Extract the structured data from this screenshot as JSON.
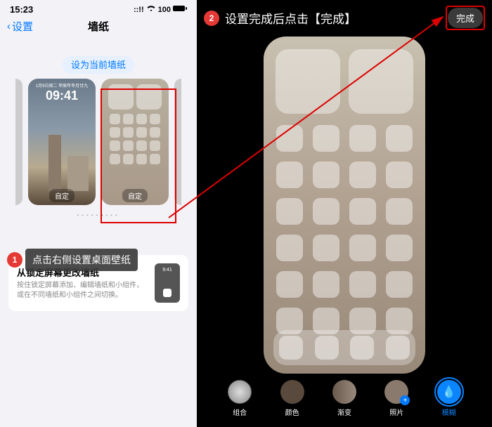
{
  "status": {
    "time": "15:23",
    "signal": "::!!",
    "wifi": "⧉",
    "battery": "100"
  },
  "nav": {
    "back": "设置",
    "title": "墙纸"
  },
  "set_current": "设为当前墙纸",
  "lock": {
    "date": "1月9日周二 甲辰年冬月廿九",
    "time": "09:41",
    "custom": "自定"
  },
  "home": {
    "custom": "自定"
  },
  "annotation1": {
    "num": "1",
    "text": "点击右侧设置桌面壁纸"
  },
  "info": {
    "title": "从锁定屏幕更改墙纸",
    "desc": "按住锁定屏幕添加、编辑墙纸和小组件，或在不同墙纸和小组件之间切换。"
  },
  "annotation2": {
    "num": "2",
    "text": "设置完成后点击【完成】"
  },
  "done": "完成",
  "options": {
    "combo": "组合",
    "color": "颜色",
    "gradient": "渐变",
    "photo": "照片",
    "blur": "模糊"
  }
}
